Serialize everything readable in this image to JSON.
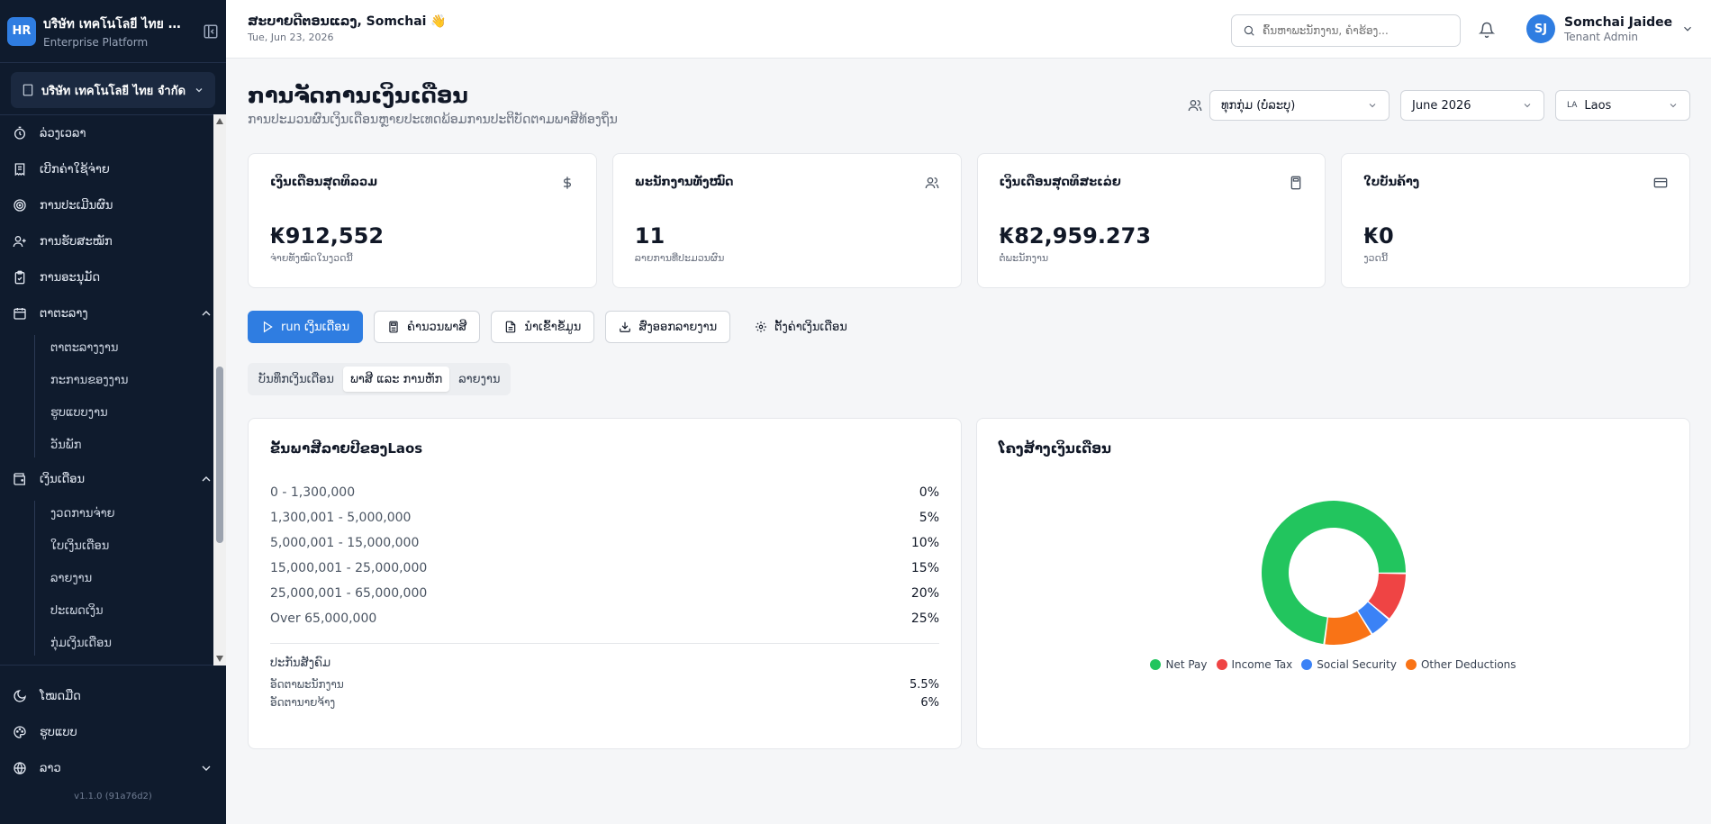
{
  "sidebar": {
    "logo": "HR",
    "company": "บริษัท เทคโนโลยี ไทย จำกัด",
    "platform": "Enterprise Platform",
    "tenant": "บริษัท เทคโนโลยี ไทย จำกัด",
    "nav": [
      {
        "label": "ລ່ວງເວລາ"
      },
      {
        "label": "ເບີກຄ່າໃຊ້ຈ່າຍ"
      },
      {
        "label": "ການປະເມີນຜົນ"
      },
      {
        "label": "ການຮັບສະໝັກ"
      },
      {
        "label": "ການອະນຸມັດ"
      }
    ],
    "schedule": {
      "label": "ຕາຕະລາງ",
      "items": [
        "ຕາຕະລາງງານ",
        "ກະການຂອງງານ",
        "ຮູບແບບງານ",
        "ວັນພັກ"
      ]
    },
    "payroll": {
      "label": "ເງິນເດືອນ",
      "items": [
        "ງວດການຈ່າຍ",
        "ໃບເງິນເດືອນ",
        "ລາຍງານ",
        "ປະເພດເງິນ",
        "ກຸ່ມເງິນເດືອນ"
      ]
    },
    "footer": {
      "theme": "ໂໝດມືດ",
      "appearance": "ຮູບແບບ",
      "language": "ລາວ",
      "version": "v1.1.0 (91a76d2)"
    }
  },
  "topbar": {
    "greeting": "ສະບາຍດີຕອນແລງ, Somchai 👋",
    "date": "Tue, Jun 23, 2026",
    "search_placeholder": "ຄົ້ນຫາພະນັກງານ, ຄຳຮ້ອງ...",
    "user_initials": "SJ",
    "user_name": "Somchai Jaidee",
    "user_role": "Tenant Admin"
  },
  "page": {
    "title": "ການຈັດການເງິນເດືອນ",
    "subtitle": "ການປະມວນຜົນເງິນເດືອນຫຼາຍປະເທດພ້ອມການປະຕິບັດຕາມພາສີທ້ອງຖິ່ນ",
    "filters": {
      "group": "ທຸກກຸ່ມ (ບໍ່ລະບຸ)",
      "period": "June 2026",
      "country_code": "LA",
      "country": "Laos"
    }
  },
  "stats": [
    {
      "label": "ເງິນເດືອນສຸດທິລວມ",
      "value": "₭912,552",
      "sub": "ຈ່າຍທັງໝົດໃນງວດນີ້",
      "icon": "dollar-icon"
    },
    {
      "label": "ພະນັກງານທັງໝົດ",
      "value": "11",
      "sub": "ລາຍການທີ່ປະມວນຜົນ",
      "icon": "users-icon"
    },
    {
      "label": "ເງິນເດືອນສຸດທິສະເລ່ຍ",
      "value": "₭82,959.273",
      "sub": "ຕໍ່ພະນັກງານ",
      "icon": "calculator-icon"
    },
    {
      "label": "ໃບບັນຄ້າງ",
      "value": "₭0",
      "sub": "ງວດນີ້",
      "icon": "card-icon"
    }
  ],
  "actions": {
    "run": "run ເງິນເດືອນ",
    "calc": "ຄຳນວນພາສີ",
    "import": "ນຳເຂົ້າຂໍ້ມູນ",
    "export": "ສົ່ງອອກລາຍງານ",
    "settings": "ຕັ້ງຄ່າເງິນເດືອນ"
  },
  "tabs": [
    "ບັນທຶກເງິນເດືອນ",
    "ພາສີ ແລະ ການຫັກ",
    "ລາຍງານ"
  ],
  "tax_panel": {
    "title": "ຂັ້ນພາສີລາຍປີຂອງLaos",
    "brackets": [
      {
        "range": "0 - 1,300,000",
        "rate": "0%"
      },
      {
        "range": "1,300,001 - 5,000,000",
        "rate": "5%"
      },
      {
        "range": "5,000,001 - 15,000,000",
        "rate": "10%"
      },
      {
        "range": "15,000,001 - 25,000,000",
        "rate": "15%"
      },
      {
        "range": "25,000,001 - 65,000,000",
        "rate": "20%"
      },
      {
        "range": "Over 65,000,000",
        "rate": "25%"
      }
    ],
    "social_security_title": "ປະກັນສັງຄົມ",
    "employee_label": "ອັດຕາພະນັກງານ",
    "employee_rate": "5.5%",
    "employer_label": "ອັດຕານາຍຈ້າງ",
    "employer_rate": "6%"
  },
  "chart_panel": {
    "title": "ໂຄງສ້າງເງິນເດືອນ"
  },
  "chart_data": {
    "type": "pie",
    "categories": [
      "Net Pay",
      "Income Tax",
      "Social Security",
      "Other Deductions"
    ],
    "values": [
      73,
      11,
      5,
      11
    ],
    "colors": [
      "#22c55e",
      "#ef4444",
      "#3b82f6",
      "#f97316"
    ],
    "title": "ໂຄງສ້າງເງິນເດືອນ",
    "donut": true,
    "legend": "bottom"
  }
}
